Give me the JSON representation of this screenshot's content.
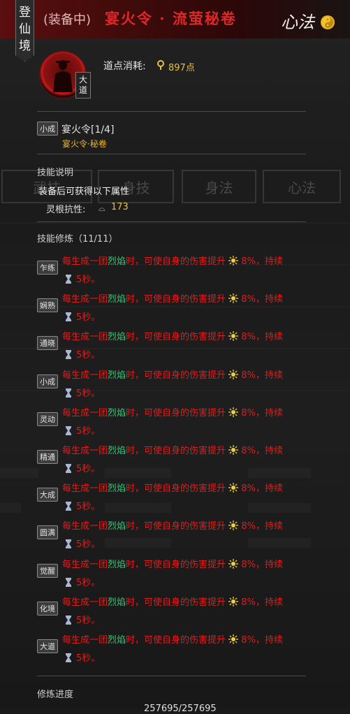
{
  "header": {
    "realm_chars": [
      "登",
      "仙",
      "境"
    ],
    "equip_state": "(装备中)",
    "title": "宴火令 · 流萤秘卷",
    "type_label": "心法"
  },
  "skill": {
    "grade_chars": [
      "大",
      "道"
    ],
    "cost_label": "道点消耗:",
    "cost_value": "897点",
    "level_badge": "小成",
    "level_name": "宴火令[1/4]",
    "source": "宴火令·秘卷"
  },
  "description": {
    "title": "技能说明",
    "text": "装备后可获得以下属性",
    "attr_label": "灵根抗性:",
    "attr_value": "173"
  },
  "cultivation": {
    "title": "技能修炼（11/11）",
    "effect_prefix": "每生成一团",
    "effect_flame": "烈焰",
    "effect_mid": "时，可使自身的伤害提升",
    "effect_pct": "8%，持续",
    "effect_duration": "5秒。",
    "tiers": [
      "乍练",
      "娴熟",
      "通晓",
      "小成",
      "灵动",
      "精通",
      "大成",
      "圆满",
      "觉醒",
      "化境",
      "大道"
    ]
  },
  "progress": {
    "title": "修炼进度",
    "value": "257695/257695"
  },
  "background": {
    "tabs": [
      "武技",
      "身技",
      "身法",
      "心法"
    ]
  },
  "colors": {
    "accent_red": "#e01c1c",
    "gold": "#e8c23a",
    "green": "#3ec47a"
  }
}
